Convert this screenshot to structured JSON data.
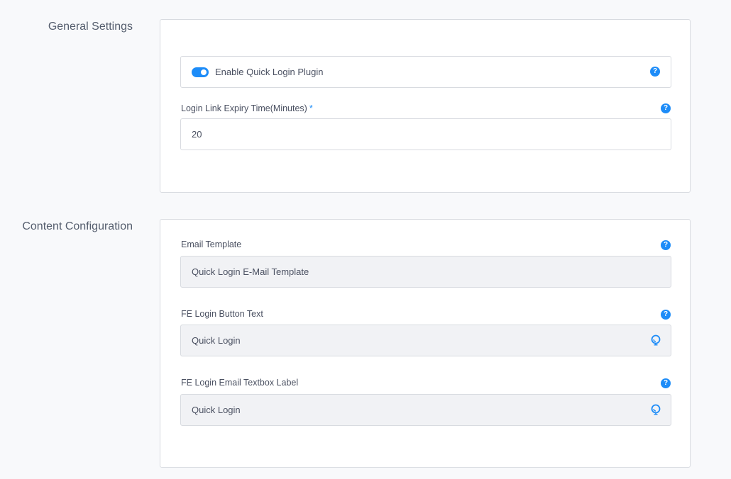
{
  "sections": {
    "general": {
      "title": "General Settings",
      "toggle": {
        "label": "Enable Quick Login Plugin",
        "enabled": true
      },
      "expiry": {
        "label": "Login Link Expiry Time(Minutes)",
        "required_mark": "*",
        "value": "20"
      }
    },
    "content": {
      "title": "Content Configuration",
      "email_template": {
        "label": "Email Template",
        "value": "Quick Login E-Mail Template"
      },
      "fe_button_text": {
        "label": "FE Login Button Text",
        "value": "Quick Login"
      },
      "fe_email_label": {
        "label": "FE Login Email Textbox Label",
        "value": "Quick Login"
      }
    }
  },
  "help_glyph": "?",
  "colors": {
    "accent": "#1d8cf8",
    "card_border": "#d8dbe0",
    "readonly_bg": "#f1f2f5",
    "page_bg": "#f8f9fb"
  },
  "icons": {
    "help": "help-icon",
    "language": "language-icon"
  }
}
